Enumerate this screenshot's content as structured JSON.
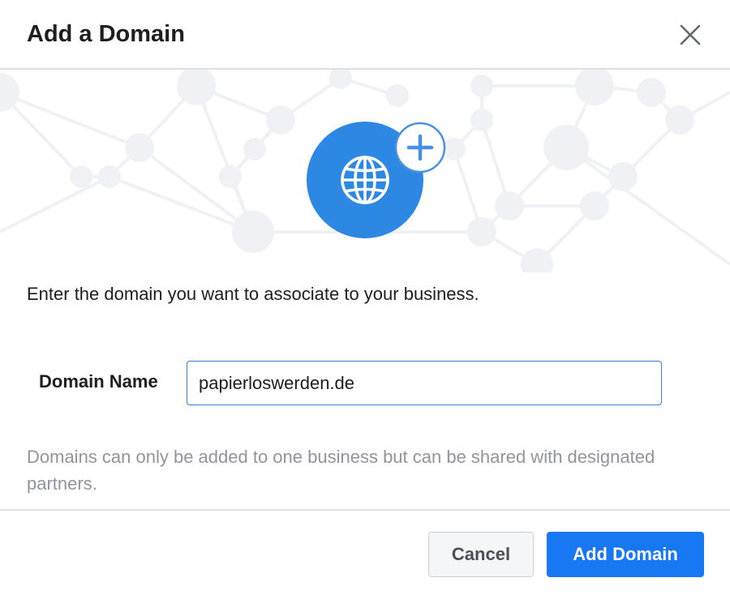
{
  "dialog": {
    "title": "Add a Domain",
    "close_icon": "close-icon"
  },
  "hero": {
    "illustration_icon": "globe-icon",
    "badge_icon": "plus-icon",
    "accent_color": "#2d88e3",
    "network_color": "#f0f1f4"
  },
  "body": {
    "prompt": "Enter the domain you want to associate to your business.",
    "field_label": "Domain Name",
    "domain_value": "papierloswerden.de",
    "helper_text": "Domains can only be added to one business but can be shared with designated partners."
  },
  "footer": {
    "cancel_label": "Cancel",
    "add_label": "Add Domain",
    "primary_color": "#1877f2"
  }
}
